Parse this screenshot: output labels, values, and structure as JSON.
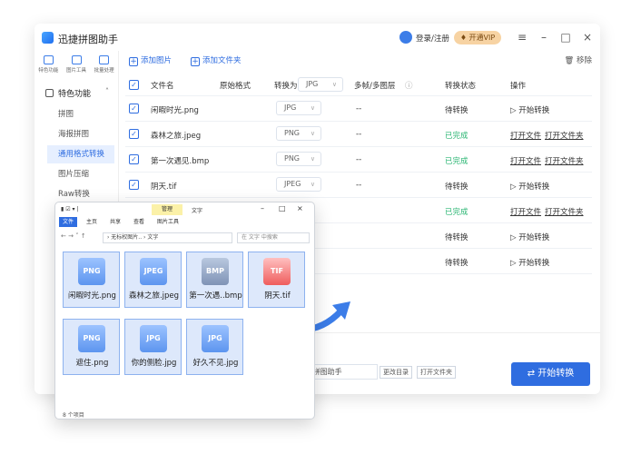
{
  "app": {
    "title": "迅捷拼图助手",
    "login": "登录/注册",
    "vip": "开通VIP"
  },
  "topnav": [
    "特色功能",
    "图片工具",
    "批量处理"
  ],
  "sidebar": {
    "group": "特色功能",
    "items": [
      "拼图",
      "海报拼图",
      "通用格式转换",
      "图片压缩",
      "Raw转换"
    ]
  },
  "toolbar": {
    "add_image": "添加图片",
    "add_folder": "添加文件夹",
    "remove": "移除"
  },
  "table": {
    "headers": {
      "filename": "文件名",
      "orig": "原始格式",
      "convert": "转换为",
      "convert_val": "JPG",
      "frames": "多帧/多图层",
      "status": "转换状态",
      "action": "操作"
    },
    "rows": [
      {
        "name": "闲暇时光.png",
        "fmt": "JPG",
        "frames": "--",
        "status": "待转换",
        "action": "开始转换"
      },
      {
        "name": "森林之旅.jpeg",
        "fmt": "PNG",
        "frames": "--",
        "status": "已完成",
        "open": "打开文件",
        "open_folder": "打开文件夹"
      },
      {
        "name": "第一次遇见.bmp",
        "fmt": "PNG",
        "frames": "--",
        "status": "已完成",
        "open": "打开文件",
        "open_folder": "打开文件夹"
      },
      {
        "name": "阴天.tif",
        "fmt": "JPEG",
        "frames": "--",
        "status": "待转换",
        "action": "开始转换"
      },
      {
        "status": "已完成",
        "open": "打开文件",
        "open_folder": "打开文件夹"
      },
      {
        "status": "待转换",
        "action": "开始转换"
      },
      {
        "status": "待转换",
        "action": "开始转换"
      }
    ]
  },
  "bottom": {
    "path": "Desktop\\拼图助手",
    "change_dir": "更改目录",
    "open_folder": "打开文件夹",
    "start": "开始转换"
  },
  "explorer": {
    "tabs": {
      "manage": "管理",
      "text": "文字"
    },
    "menu": [
      "文件",
      "主页",
      "共享",
      "查看",
      "图片工具"
    ],
    "address": "› 无标权图片.. › 文字",
    "search": "在 文字 中搜索",
    "files": [
      {
        "badge": "PNG",
        "name": "闲暇时光.png"
      },
      {
        "badge": "JPEG",
        "name": "森林之旅.jpeg"
      },
      {
        "badge": "BMP",
        "name": "第一次遇..bmp"
      },
      {
        "badge": "TIF",
        "name": "阴天.tif"
      },
      {
        "badge": "PNG",
        "name": "遮住.png"
      },
      {
        "badge": "JPG",
        "name": "你的侧脸.jpg"
      },
      {
        "badge": "JPG",
        "name": "好久不见.jpg"
      }
    ],
    "count": "8 个项目"
  }
}
